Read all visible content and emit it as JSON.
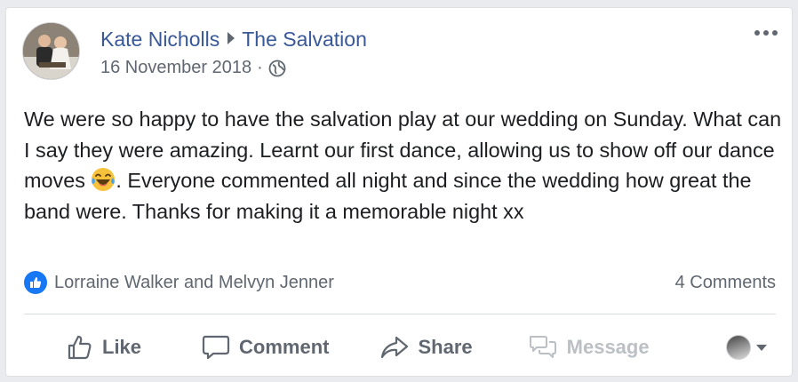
{
  "post": {
    "author": "Kate Nicholls",
    "target_page": "The Salvation",
    "date": "16 November 2018",
    "separator": "·",
    "audience_icon": "globe-icon",
    "text_before_emoji": "We were so happy to have the salvation play at our wedding on Sunday. What can I say they were amazing. Learnt our first dance, allowing us to show off our dance moves ",
    "emoji": "laughing-tears-emoji",
    "text_after_emoji": ". Everyone commented all night and since the wedding how great the band were. Thanks for making it a memorable night xx"
  },
  "reactions": {
    "icon": "like-icon",
    "names": "Lorraine Walker and Melvyn Jenner",
    "comments": "4 Comments"
  },
  "actions": {
    "like": "Like",
    "comment": "Comment",
    "share": "Share",
    "message": "Message"
  },
  "colors": {
    "link": "#385898",
    "secondary_text": "#606770",
    "like_blue": "#1877f2",
    "disabled": "#bcc0c4"
  }
}
